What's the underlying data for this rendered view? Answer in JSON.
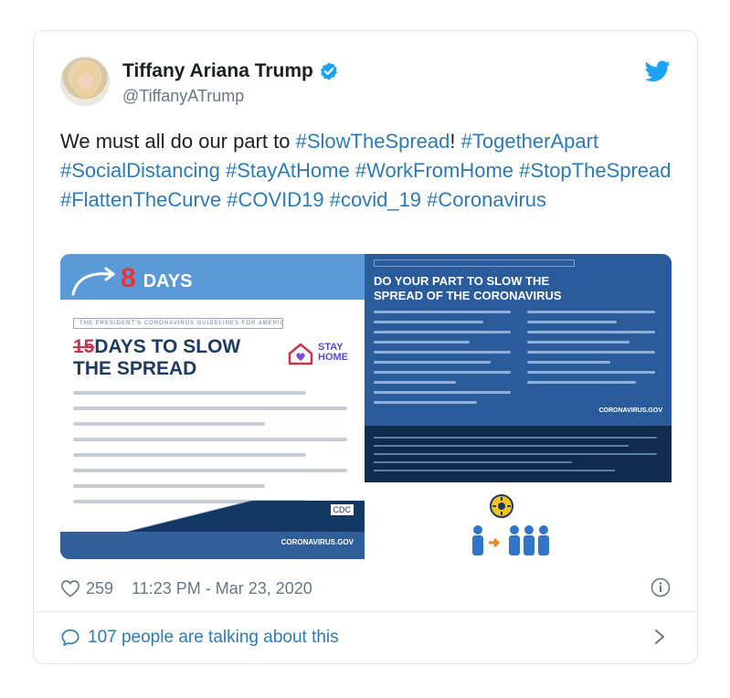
{
  "author": {
    "name": "Tiffany Ariana Trump",
    "handle": "@TiffanyATrump"
  },
  "tweet": {
    "segments": [
      {
        "text": "We must all do our part to ",
        "tag": false
      },
      {
        "text": "#SlowTheSpread",
        "tag": true
      },
      {
        "text": "! ",
        "tag": false
      },
      {
        "text": "#TogetherApart",
        "tag": true
      },
      {
        "text": " ",
        "tag": false
      },
      {
        "text": "#SocialDistancing",
        "tag": true
      },
      {
        "text": " ",
        "tag": false
      },
      {
        "text": "#StayAtHome",
        "tag": true
      },
      {
        "text": " ",
        "tag": false
      },
      {
        "text": "#WorkFromHome",
        "tag": true
      },
      {
        "text": " ",
        "tag": false
      },
      {
        "text": "#StopTheSpread",
        "tag": true
      },
      {
        "text": " ",
        "tag": false
      },
      {
        "text": "#FlattenTheCurve",
        "tag": true
      },
      {
        "text": " ",
        "tag": false
      },
      {
        "text": "#COVID19",
        "tag": true
      },
      {
        "text": "  ",
        "tag": false
      },
      {
        "text": "#covid_19",
        "tag": true
      },
      {
        "text": " ",
        "tag": false
      },
      {
        "text": "#Coronavirus",
        "tag": true
      }
    ]
  },
  "media": {
    "left": {
      "countdown_number": "8",
      "countdown_label": "DAYS",
      "guideline_header": "THE PRESIDENT'S CORONAVIRUS GUIDELINES FOR AMERICA",
      "title_struck": "15",
      "title_line1": "DAYS TO SLOW",
      "title_line2": "THE SPREAD",
      "stay_home_line1": "STAY",
      "stay_home_line2": "HOME",
      "cdc_label": "CDC",
      "site": "CORONAVIRUS.GOV"
    },
    "right": {
      "title_line1": "DO YOUR PART TO SLOW THE",
      "title_line2": "SPREAD OF THE CORONAVIRUS",
      "site": "CORONAVIRUS.GOV"
    }
  },
  "meta": {
    "likes": "259",
    "timestamp": "11:23 PM - Mar 23, 2020"
  },
  "conversation": {
    "label": "107 people are talking about this"
  },
  "colors": {
    "link": "#2b7bb9",
    "muted": "#697882",
    "verified": "#1da1f2"
  }
}
